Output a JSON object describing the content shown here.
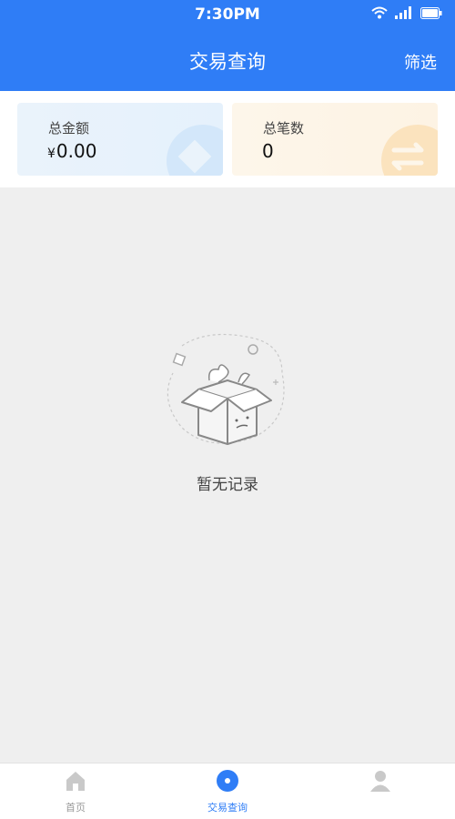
{
  "status_bar": {
    "time": "7:30PM"
  },
  "header": {
    "title": "交易查询",
    "filter_label": "筛选"
  },
  "summary": {
    "total_amount": {
      "label": "总金额",
      "currency": "¥",
      "value": "0.00"
    },
    "total_count": {
      "label": "总笔数",
      "value": "0"
    }
  },
  "empty_state": {
    "message": "暂无记录"
  },
  "tabbar": {
    "items": [
      {
        "label": "首页",
        "icon": "home-icon"
      },
      {
        "label": "交易查询",
        "icon": "search-circle-icon"
      },
      {
        "label": "",
        "icon": "profile-icon"
      }
    ]
  },
  "colors": {
    "primary": "#2f7df6",
    "background": "#efefef"
  }
}
